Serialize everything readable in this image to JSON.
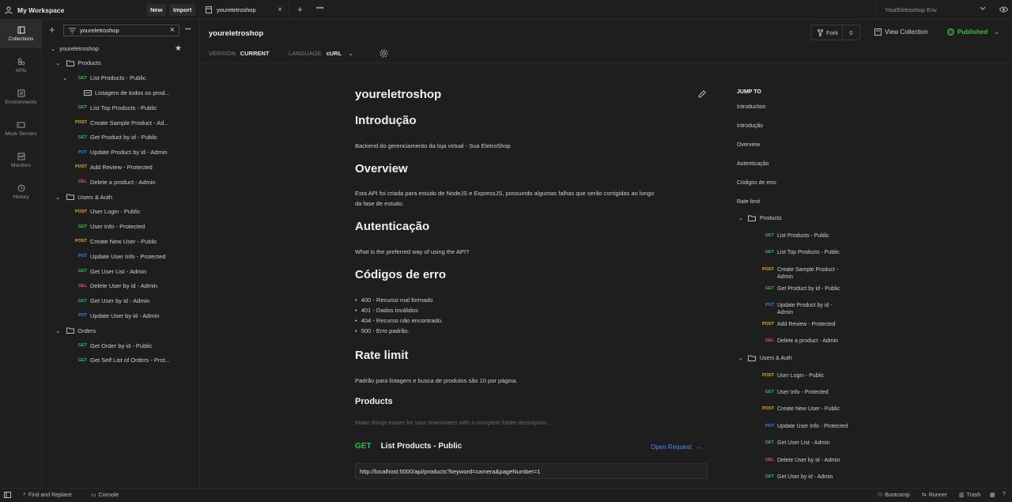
{
  "topbar": {
    "workspace": "My Workspace",
    "new_label": "New",
    "import_label": "Import",
    "tab_label": "youreletroshop",
    "environment": "YourEletroshop Env"
  },
  "rail": [
    {
      "label": "Collections",
      "icon": "collections-icon"
    },
    {
      "label": "APIs",
      "icon": "apis-icon"
    },
    {
      "label": "Environments",
      "icon": "environments-icon"
    },
    {
      "label": "Mock Servers",
      "icon": "mock-servers-icon"
    },
    {
      "label": "Monitors",
      "icon": "monitors-icon"
    },
    {
      "label": "History",
      "icon": "history-icon"
    }
  ],
  "sidebar": {
    "search_value": "youreletroshop",
    "tree": [
      {
        "type": "collection",
        "label": "youreletroshop"
      },
      {
        "type": "folder",
        "label": "Products"
      },
      {
        "type": "request",
        "method": "GET",
        "label": "List Products - Public",
        "expanded": true
      },
      {
        "type": "example",
        "label": "Listagem de todos os prod..."
      },
      {
        "type": "request",
        "method": "GET",
        "label": "List Top Products - Public"
      },
      {
        "type": "request",
        "method": "POST",
        "label": "Create Sample Product - Ad..."
      },
      {
        "type": "request",
        "method": "GET",
        "label": "Get Product by id - Public"
      },
      {
        "type": "request",
        "method": "PUT",
        "label": "Update Product by id - Admin"
      },
      {
        "type": "request",
        "method": "POST",
        "label": "Add Review - Protected"
      },
      {
        "type": "request",
        "method": "DEL",
        "label": "Delete a product - Admin"
      },
      {
        "type": "folder",
        "label": "Users & Auth"
      },
      {
        "type": "request",
        "method": "POST",
        "label": "User Login - Public"
      },
      {
        "type": "request",
        "method": "GET",
        "label": "User Info - Protected"
      },
      {
        "type": "request",
        "method": "POST",
        "label": "Create New User - Public"
      },
      {
        "type": "request",
        "method": "PUT",
        "label": "Update User Info - Protected"
      },
      {
        "type": "request",
        "method": "GET",
        "label": "Get User List - Admin"
      },
      {
        "type": "request",
        "method": "DEL",
        "label": "Delete User by id - Admin"
      },
      {
        "type": "request",
        "method": "GET",
        "label": "Get User by id - Admin"
      },
      {
        "type": "request",
        "method": "PUT",
        "label": "Update User by id - Admin"
      },
      {
        "type": "folder",
        "label": "Orders"
      },
      {
        "type": "request",
        "method": "GET",
        "label": "Get Order by id - Public"
      },
      {
        "type": "request",
        "method": "GET",
        "label": "Get Self List of Orders - Prot..."
      }
    ]
  },
  "header": {
    "title": "youreletroshop",
    "version_label": "VERSION",
    "version_value": "CURRENT",
    "language_label": "LANGUAGE",
    "language_value": "cURL",
    "fork_label": "Fork",
    "fork_count": "0",
    "view_collection": "View Collection",
    "published": "Published"
  },
  "doc": {
    "title": "youreletroshop",
    "h_intro": "Introdução",
    "p_intro": "Backend do gerenciamento da loja virtual - Sua EletroShop",
    "h_overview": "Overview",
    "p_overview_1": "Esta API foi criada para estudo de NodeJS e ExpressJS, possuindo algumas falhas que serão corrigidas ao longo",
    "p_overview_2": "da fase de estudo.",
    "h_auth": "Autenticação",
    "p_auth": "What is the preferred way of using the API?",
    "h_errors": "Códigos de erro",
    "errors": [
      "400 - Recurso mal formado",
      "401 - Dados inválidos",
      "404 - Recurso não encontrado.",
      "500 - Erro padrão."
    ],
    "h_rate": "Rate limit",
    "p_rate": "Padrão para listagem e busca de produtos são 10 por página.",
    "h_products": "Products",
    "p_products": "Make things easier for your teammates with a complete folder description.",
    "req_method": "GET",
    "req_name": "List Products - Public",
    "open_request": "Open Request",
    "req_url": "http://localhost:5000/api/products?keyword=camera&pageNumber=1"
  },
  "jump": {
    "heading": "JUMP TO",
    "links": [
      "Introduction",
      "Introdução",
      "Overview",
      "Autenticação",
      "Códigos de erro",
      "Rate limit"
    ],
    "folder_products": "Products",
    "products": [
      {
        "method": "GET",
        "label": "List Products - Public"
      },
      {
        "method": "GET",
        "label": "List Top Products - Public"
      },
      {
        "method": "POST",
        "label": "Create Sample Product -",
        "label2": "Admin"
      },
      {
        "method": "GET",
        "label": "Get Product by id - Public"
      },
      {
        "method": "PUT",
        "label": "Update Product by id -",
        "label2": "Admin"
      },
      {
        "method": "POST",
        "label": "Add Review - Protected"
      },
      {
        "method": "DEL",
        "label": "Delete a product - Admin"
      }
    ],
    "folder_users": "Users & Auth",
    "users": [
      {
        "method": "POST",
        "label": "User Login - Public"
      },
      {
        "method": "GET",
        "label": "User Info - Protected"
      },
      {
        "method": "POST",
        "label": "Create New User - Public"
      },
      {
        "method": "PUT",
        "label": "Update User Info - Protected"
      },
      {
        "method": "GET",
        "label": "Get User List - Admin"
      },
      {
        "method": "DEL",
        "label": "Delete User by id - Admin"
      },
      {
        "method": "GET",
        "label": "Get User by id - Admin"
      }
    ]
  },
  "bottombar": {
    "find_replace": "Find and Replace",
    "console": "Console",
    "bootcamp": "Bootcamp",
    "runner": "Runner",
    "trash": "Trash"
  },
  "colors": {
    "get": "#3fb950",
    "post": "#e5a83a",
    "put": "#3b82f6",
    "del": "#e5534b",
    "published": "#3fb950",
    "link": "#4a8cf7"
  }
}
